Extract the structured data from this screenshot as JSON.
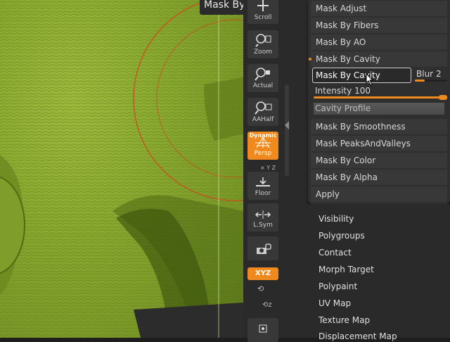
{
  "tooltip": "Mask By Cavity",
  "shelf": {
    "scroll": "Scroll",
    "zoom": "Zoom",
    "actual": "Actual",
    "aahalf": "AAHalf",
    "persp_top": "Dynamic",
    "persp": "Persp",
    "floor": "Floor",
    "lsym": "L.Sym",
    "xyz": "XYZ",
    "accent": "#f0891e"
  },
  "palette": {
    "items": [
      "Mask Adjust",
      "Mask By Fibers",
      "Mask By AO",
      "Mask By Cavity"
    ],
    "cavity_field": "Mask By Cavity",
    "blur_label": "Blur",
    "blur_value": "2",
    "blur_fraction": 0.3,
    "intensity_label": "Intensity",
    "intensity_value": "100",
    "intensity_fraction": 1.0,
    "cavity_profile": "Cavity Profile",
    "more_items": [
      "Mask By Smoothness",
      "Mask PeaksAndValleys",
      "Mask By Color",
      "Mask By Alpha",
      "Apply"
    ]
  },
  "lower_menu": [
    "Visibility",
    "Polygroups",
    "Contact",
    "Morph Target",
    "Polypaint",
    "UV Map",
    "Texture Map",
    "Displacement Map"
  ]
}
